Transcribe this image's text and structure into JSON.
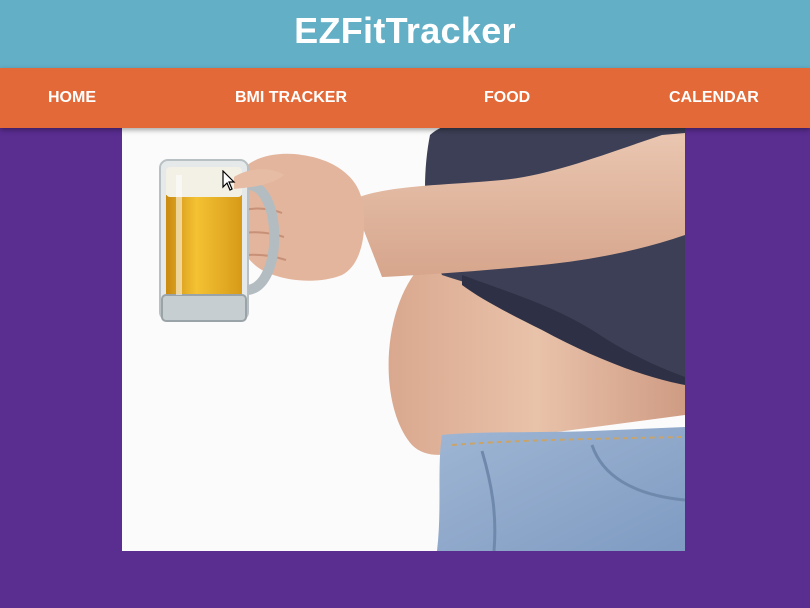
{
  "header": {
    "title": "EZFitTracker",
    "bg_color": "#63afc6"
  },
  "nav": {
    "bg_color": "#e36a38",
    "items": [
      {
        "label": "HOME"
      },
      {
        "label": "BMI TRACKER"
      },
      {
        "label": "FOOD"
      },
      {
        "label": "CALENDAR"
      }
    ]
  },
  "page": {
    "bg_color": "#5a2d91"
  },
  "hero_image": {
    "alt": "",
    "icon": "hero-photo"
  }
}
